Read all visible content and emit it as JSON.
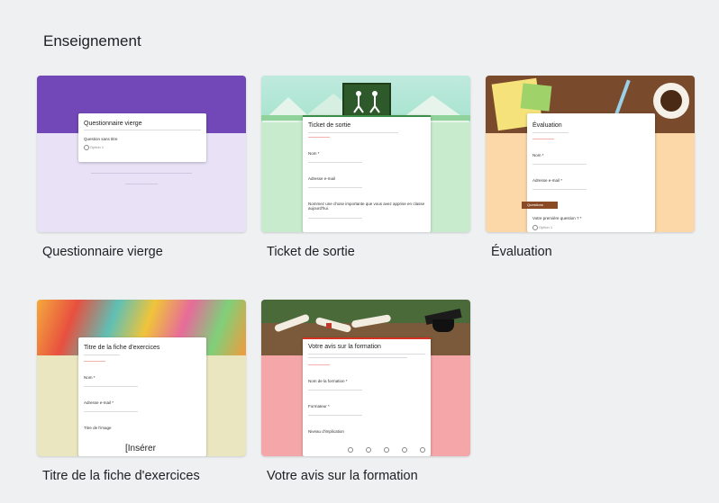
{
  "section": {
    "title": "Enseignement"
  },
  "templates": [
    {
      "label": "Questionnaire vierge",
      "accent": "#7248b9",
      "sheet_title": "Questionnaire vierge",
      "question": "Question sans titre",
      "option": "Option 1"
    },
    {
      "label": "Ticket de sortie",
      "accent": "#8fd39b",
      "sheet_title": "Ticket de sortie",
      "field1": "Nom *",
      "field2": "Adresse e-mail",
      "field3": "Nommez une chose importante que vous avez apprise en classe aujourd'hui."
    },
    {
      "label": "Évaluation",
      "accent": "#fcd8a8",
      "sheet_title": "Évaluation",
      "field1": "Nom *",
      "field2": "Adresse e-mail *",
      "section_tag": "Questions",
      "question": "Votre première question ? *",
      "option": "Option 1"
    },
    {
      "label": "Titre de la fiche d'exercices",
      "accent": "#eae6bf",
      "sheet_title": "Titre de la fiche d'exercices",
      "field1": "Nom *",
      "field2": "Adresse e-mail *",
      "field3": "Titre de l'image",
      "insert_text": "[Insérer"
    },
    {
      "label": "Votre avis sur la formation",
      "accent": "#f4a6a8",
      "sheet_title": "Votre avis sur la formation",
      "field1": "Nom de la formation *",
      "field2": "Formateur *",
      "field3": "Niveau d'implication"
    }
  ]
}
